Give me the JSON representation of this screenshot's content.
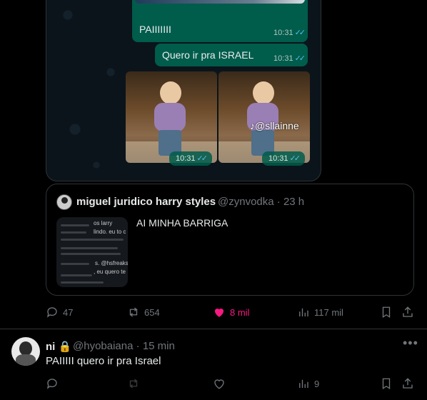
{
  "whatsapp": {
    "msg1": {
      "text": "PAIIIIIII",
      "time": "10:31"
    },
    "msg2": {
      "text": "Quero ir pra ISRAEL",
      "time": "10:31"
    },
    "video_watermark": "@sllainne",
    "video_times": [
      "10:31",
      "10:31"
    ]
  },
  "quoted_tweet": {
    "author_name": "miguel juridico harry styles",
    "handle": "@zynvodka",
    "time": "23 h",
    "text": "AI MINHA BARRIGA",
    "thumb_snippets": [
      "os larry",
      "lindo. eu to c",
      "s. @hsfreaks",
      ", eu quero te"
    ]
  },
  "main_actions": {
    "replies": "47",
    "reposts": "654",
    "likes": "8 mil",
    "views": "117 mil"
  },
  "reply_tweet": {
    "author_name": "ni",
    "handle": "@hyobaiana",
    "time": "15 min",
    "text": "PAIIIII quero ir pra Israel",
    "views": "9"
  },
  "colors": {
    "like_active": "#f91880",
    "wa_bubble": "#005c4b",
    "read_ticks": "#53bdeb"
  }
}
